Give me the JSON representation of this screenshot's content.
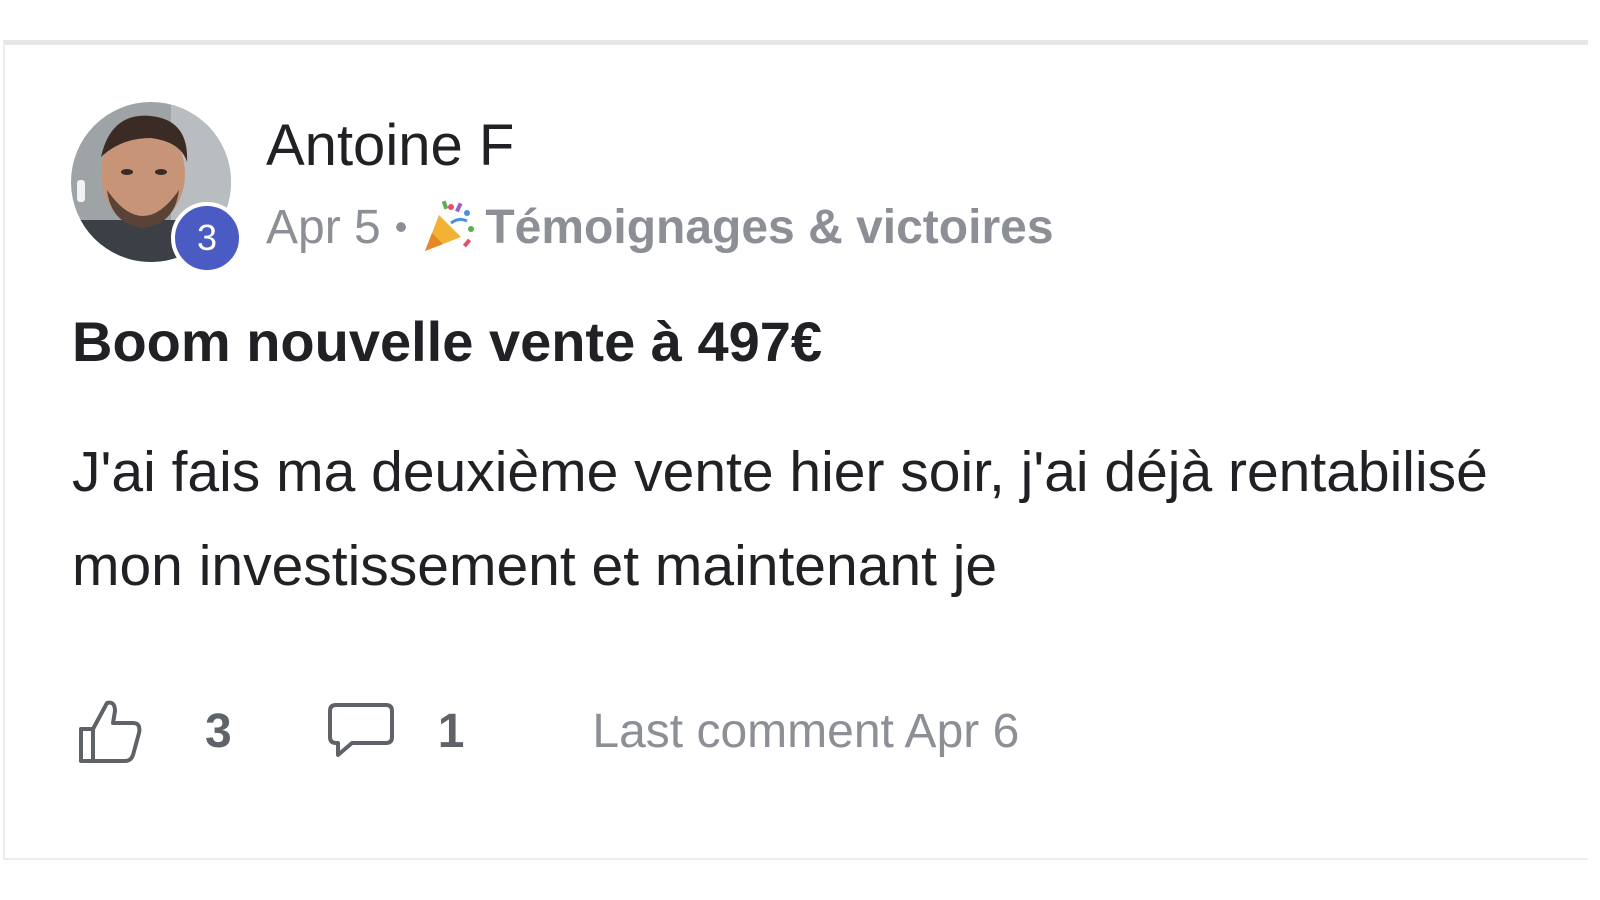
{
  "post": {
    "author": {
      "name": "Antoine F",
      "level": "3"
    },
    "date": "Apr 5",
    "separator": "•",
    "category": {
      "icon": "party-popper-icon",
      "label": "Témoignages & victoires"
    },
    "title": "Boom nouvelle vente à 497€",
    "body": "J'ai fais ma deuxième vente hier soir, j'ai déjà rentabilisé mon investissement et maintenant je",
    "footer": {
      "likes": "3",
      "comments": "1",
      "last_comment": "Last comment Apr 6"
    }
  },
  "colors": {
    "badge": "#4a5bc4",
    "text": "#202124",
    "muted": "#8c8f95"
  }
}
